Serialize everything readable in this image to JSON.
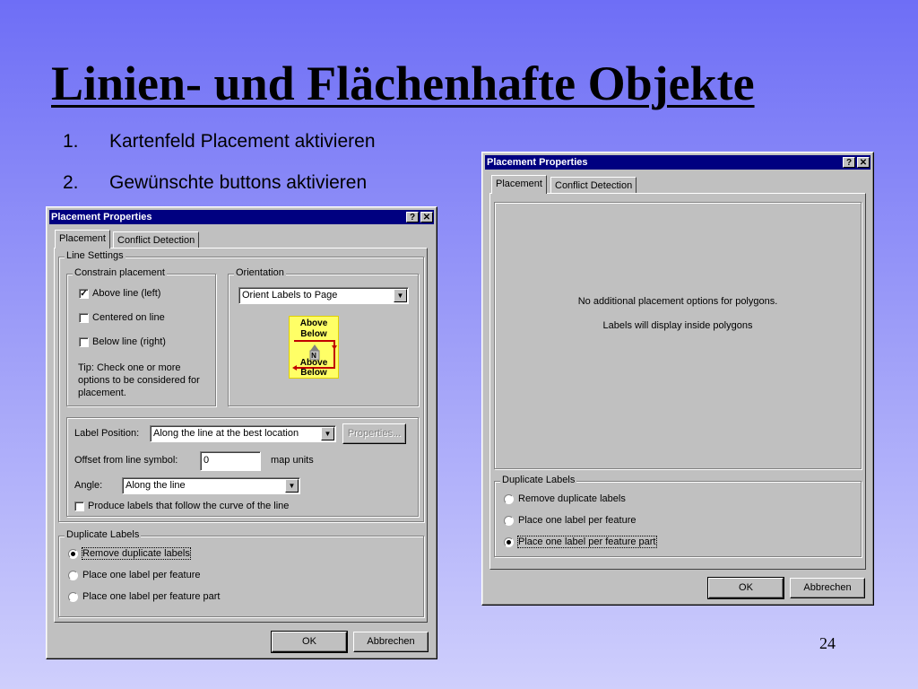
{
  "slide": {
    "title": "Linien- und Flächenhafte Objekte",
    "steps": [
      {
        "num": "1.",
        "text": "Kartenfeld Placement aktivieren"
      },
      {
        "num": "2.",
        "text": "Gewünschte buttons aktivieren"
      }
    ],
    "page_number": "24"
  },
  "dialog_line": {
    "title": "Placement Properties",
    "help_btn": "?",
    "close_btn": "✕",
    "tabs": [
      "Placement",
      "Conflict Detection"
    ],
    "line_settings": {
      "label": "Line Settings",
      "constrain": {
        "label": "Constrain placement",
        "above": {
          "label": "Above line (left)",
          "checked": true
        },
        "centered": {
          "label": "Centered on line",
          "checked": false
        },
        "below": {
          "label": "Below line (right)",
          "checked": false
        },
        "tip": "Tip:  Check one or more options to be considered for placement."
      },
      "orientation": {
        "label": "Orientation",
        "value": "Orient Labels to Page",
        "icon": {
          "above1": "Above",
          "below1": "Below",
          "n": "N",
          "above2": "Above",
          "below2": "Below"
        }
      },
      "label_position": {
        "label": "Label Position:",
        "value": "Along the line at the best location",
        "properties_btn": "Properties..."
      },
      "offset": {
        "label": "Offset from line symbol:",
        "value": "0",
        "units": "map units"
      },
      "angle": {
        "label": "Angle:",
        "value": "Along the line"
      },
      "curve": {
        "label": "Produce labels that follow the curve of the line",
        "checked": false
      }
    },
    "duplicate": {
      "label": "Duplicate Labels",
      "options": [
        {
          "label": "Remove duplicate labels",
          "selected": true
        },
        {
          "label": "Place one label per feature",
          "selected": false
        },
        {
          "label": "Place one label per feature part",
          "selected": false
        }
      ]
    },
    "ok": "OK",
    "cancel": "Abbrechen"
  },
  "dialog_poly": {
    "title": "Placement Properties",
    "help_btn": "?",
    "close_btn": "✕",
    "tabs": [
      "Placement",
      "Conflict Detection"
    ],
    "message1": "No additional placement options for polygons.",
    "message2": "Labels will display inside polygons",
    "duplicate": {
      "label": "Duplicate Labels",
      "options": [
        {
          "label": "Remove duplicate labels",
          "selected": false
        },
        {
          "label": "Place one label per feature",
          "selected": false
        },
        {
          "label": "Place one label per feature part",
          "selected": true
        }
      ]
    },
    "ok": "OK",
    "cancel": "Abbrechen"
  }
}
